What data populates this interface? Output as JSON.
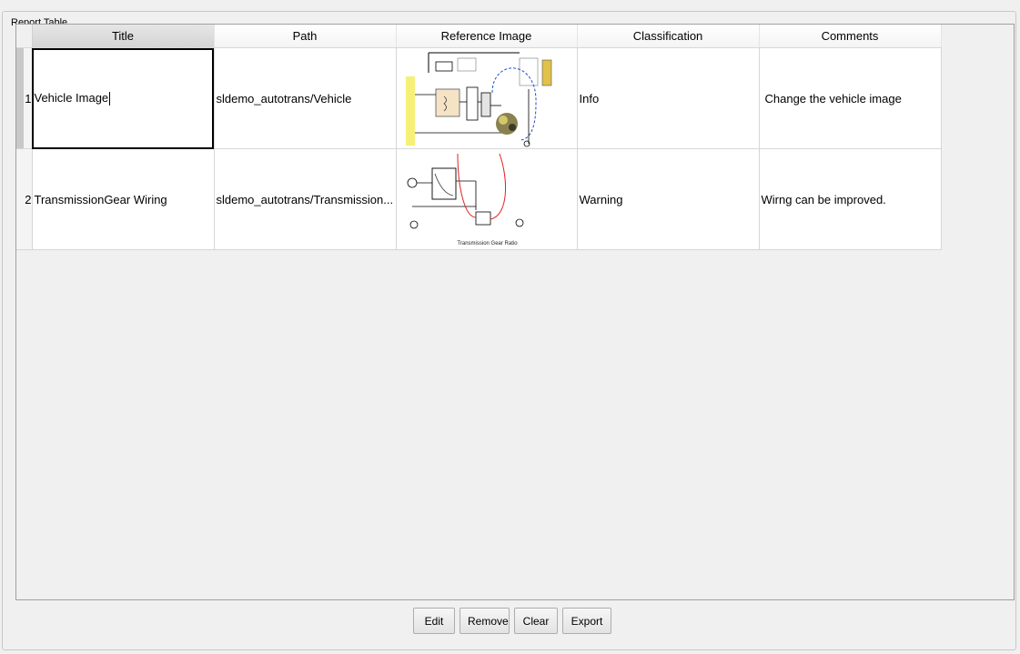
{
  "groupbox": {
    "label": "Report Table"
  },
  "table": {
    "columns": [
      "Title",
      "Path",
      "Reference Image",
      "Classification",
      "Comments"
    ],
    "rows": [
      {
        "num": "1",
        "title": "Vehicle Image",
        "path": "sldemo_autotrans/Vehicle",
        "image_icon": "vehicle-diagram-thumbnail",
        "classification": "Info",
        "comments": "Change the vehicle image"
      },
      {
        "num": "2",
        "title": "TransmissionGear Wiring",
        "path": "sldemo_autotrans/Transmission...",
        "image_icon": "transmission-diagram-thumbnail",
        "image_caption": "Transmission Gear Ratio",
        "classification": "Warning",
        "comments": "Wirng can be improved."
      }
    ]
  },
  "buttons": {
    "edit": "Edit",
    "remove": "Remove",
    "clear": "Clear",
    "export": "Export"
  }
}
